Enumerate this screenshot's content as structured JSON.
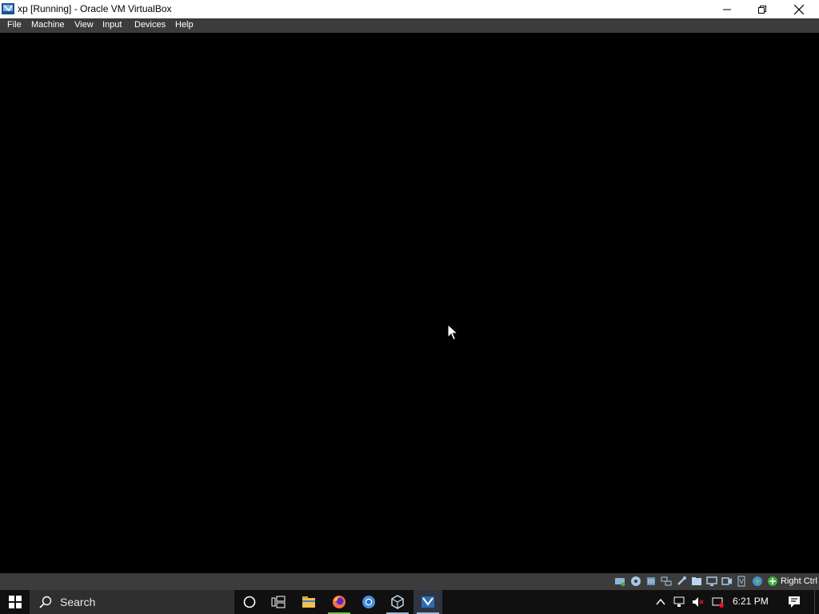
{
  "window": {
    "title": "xp [Running] - Oracle VM VirtualBox",
    "icon": "virtualbox-vm-icon",
    "controls": [
      "minimize-icon",
      "restore-icon",
      "close-icon"
    ]
  },
  "menu": {
    "items": [
      {
        "label": "File"
      },
      {
        "label": "Machine"
      },
      {
        "label": "View"
      },
      {
        "label": "Input"
      },
      {
        "label": "Devices"
      },
      {
        "label": "Help"
      }
    ]
  },
  "statusbar": {
    "icons": [
      "hard-disk-icon",
      "optical-drive-icon",
      "audio-icon",
      "network-icon",
      "usb-icon",
      "shared-folders-icon",
      "display-icon",
      "video-capture-icon",
      "virtualization-icon",
      "cpu-icon",
      "mouse-integration-icon",
      "keyboard-capture-icon"
    ],
    "host_key": "Right Ctrl"
  },
  "taskbar": {
    "search_placeholder": "Search",
    "pinned": [
      "cortana-icon",
      "task-view-icon",
      "file-explorer-icon",
      "firefox-icon",
      "chrome-icon",
      "virtualbox-manager-icon",
      "virtualbox-vm-icon"
    ],
    "tray_icons": [
      "show-hidden-icons-icon",
      "network-icon",
      "volume-muted-icon",
      "power-icon"
    ],
    "time": "6:21 PM"
  },
  "colors": {
    "titlebar": "#ffffff",
    "menubar": "#3c3c3c",
    "vm_screen": "#000000",
    "taskbar": "#101010",
    "search_box": "#2f2f2f"
  }
}
